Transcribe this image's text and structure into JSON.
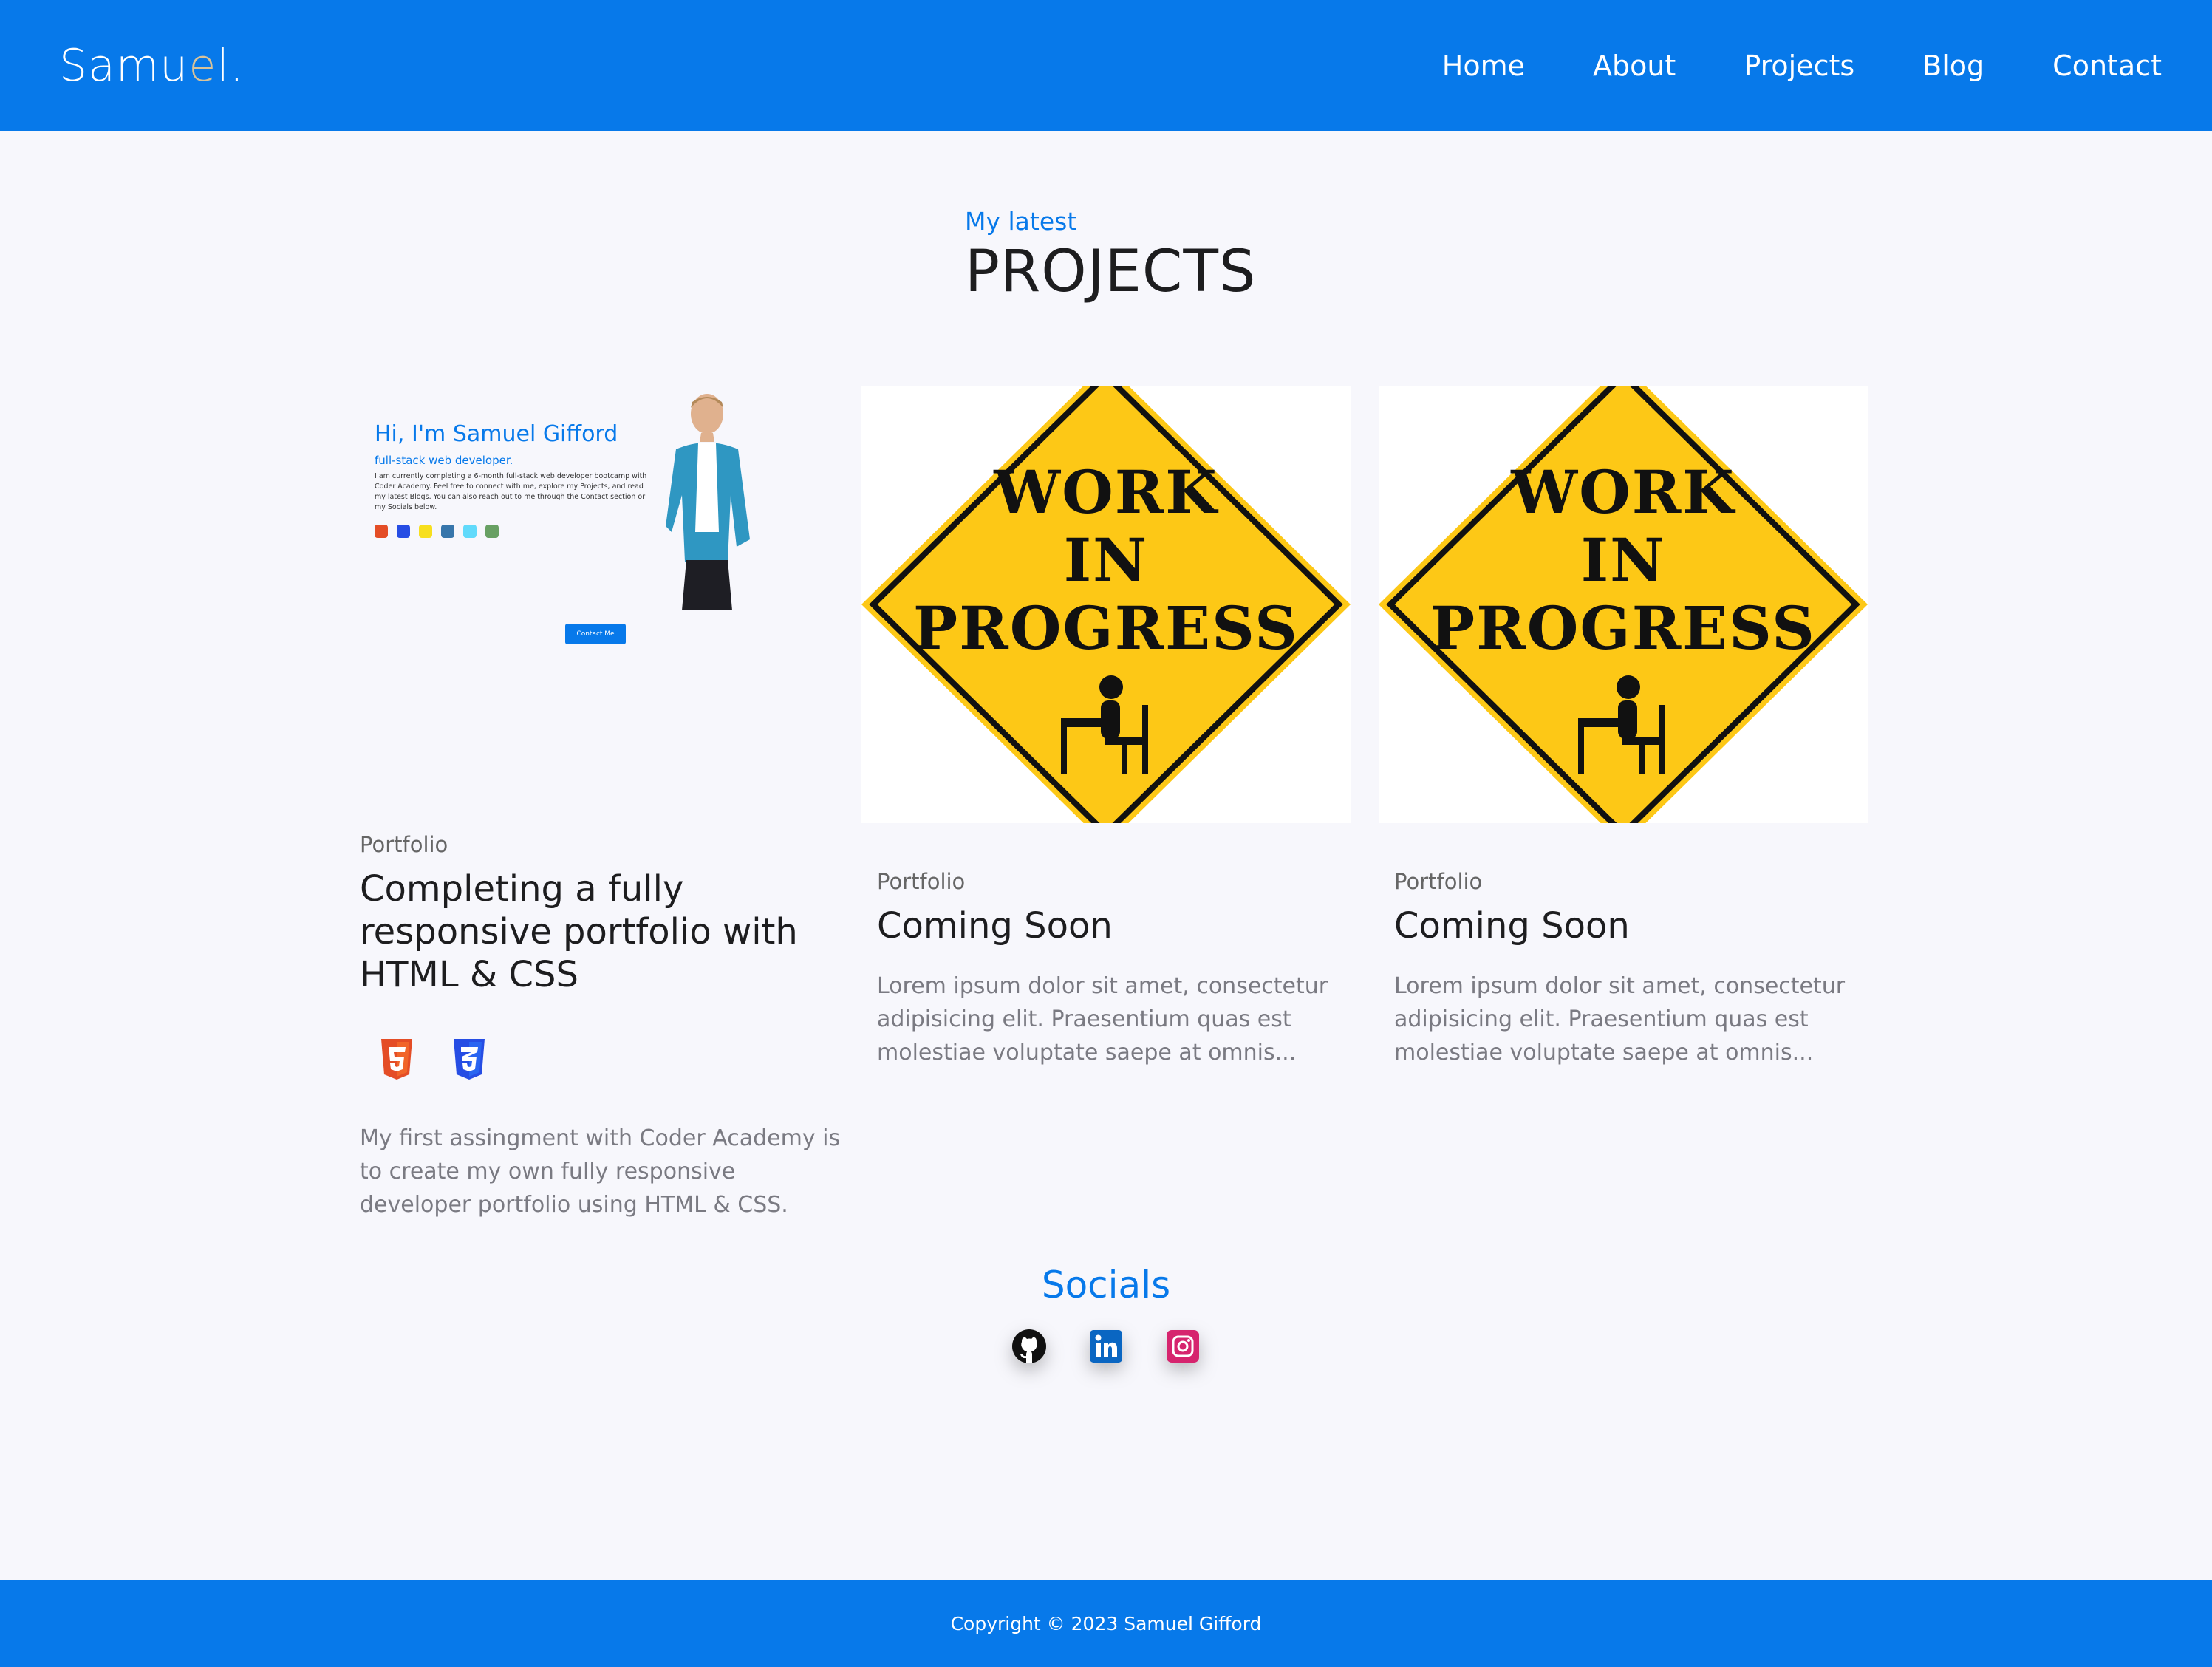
{
  "header": {
    "logo_prefix": "Samu",
    "logo_accent": "e",
    "logo_suffix": "l.",
    "nav": [
      "Home",
      "About",
      "Projects",
      "Blog",
      "Contact"
    ]
  },
  "projects_section": {
    "kicker": "My latest",
    "title": "PROJECTS"
  },
  "cards": [
    {
      "preview": {
        "greeting": "Hi, I'm Samuel Gifford",
        "subtitle": "full-stack web developer.",
        "text": "I am currently completing a 6-month full-stack web developer bootcamp with Coder Academy. Feel free to connect with me, explore my Projects, and read my latest Blogs. You can also reach out to me through the Contact section or my Socials below.",
        "button": "Contact Me"
      },
      "category": "Portfolio",
      "title": "Completing a fully responsive portfolio with HTML & CSS",
      "tech_icons": [
        "html5-icon",
        "css3-icon"
      ],
      "description": "My first assingment with Coder Academy is to create my own fully responsive developer portfolio using HTML & CSS."
    },
    {
      "sign_lines": [
        "WORK",
        "IN",
        "PROGRESS"
      ],
      "category": "Portfolio",
      "title": "Coming Soon",
      "description": "Lorem ipsum dolor sit amet, consectetur adipisicing elit. Praesentium quas est molestiae voluptate saepe at omnis..."
    },
    {
      "sign_lines": [
        "WORK",
        "IN",
        "PROGRESS"
      ],
      "category": "Portfolio",
      "title": "Coming Soon",
      "description": "Lorem ipsum dolor sit amet, consectetur adipisicing elit. Praesentium quas est molestiae voluptate saepe at omnis..."
    }
  ],
  "socials": {
    "title": "Socials",
    "icons": [
      "github-icon",
      "linkedin-icon",
      "instagram-icon"
    ]
  },
  "footer": {
    "copyright": "Copyright © 2023 Samuel Gifford"
  },
  "colors": {
    "brand_blue": "#0779ea",
    "sign_yellow": "#fdc816",
    "html_orange": "#e44d26",
    "css_blue": "#264de4",
    "instagram_pink": "#d6246e",
    "linkedin_blue": "#0a66c2"
  }
}
